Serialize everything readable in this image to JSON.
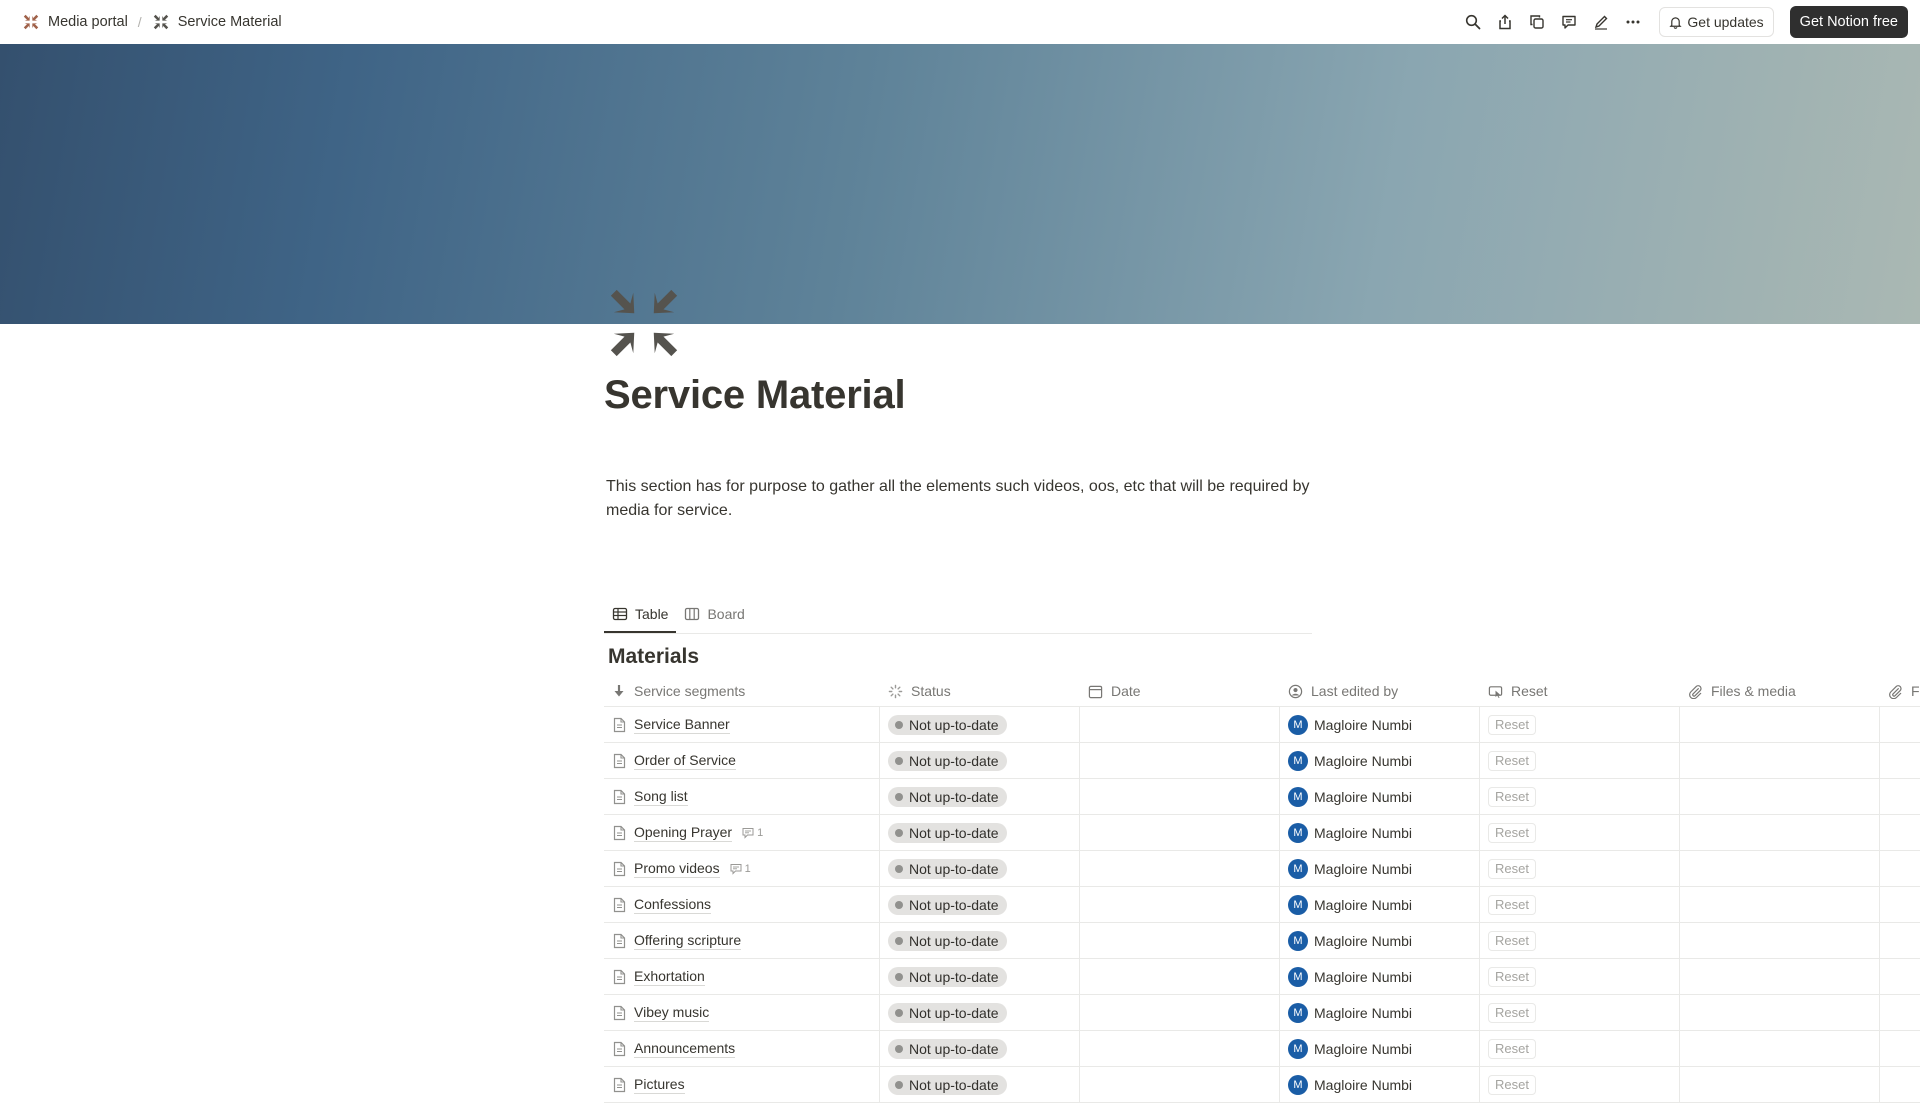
{
  "breadcrumb": [
    {
      "label": "Media portal"
    },
    {
      "label": "Service Material"
    }
  ],
  "topbar": {
    "separator": "/",
    "get_updates": "Get updates",
    "get_notion_free": "Get Notion free"
  },
  "page": {
    "title": "Service Material",
    "description": "This section has for purpose to gather all the elements such videos, oos, etc that will be required by media for service."
  },
  "views": [
    {
      "label": "Table",
      "icon": "table-icon",
      "active": true
    },
    {
      "label": "Board",
      "icon": "board-icon",
      "active": false
    }
  ],
  "database": {
    "title": "Materials",
    "columns": [
      {
        "label": "Service segments",
        "icon": "sort-arrow-icon"
      },
      {
        "label": "Status",
        "icon": "status-icon"
      },
      {
        "label": "Date",
        "icon": "calendar-icon"
      },
      {
        "label": "Last edited by",
        "icon": "person-icon"
      },
      {
        "label": "Reset",
        "icon": "button-icon"
      },
      {
        "label": "Files & media",
        "icon": "paperclip-icon"
      },
      {
        "label": "F",
        "icon": "paperclip-icon"
      }
    ],
    "rows": [
      {
        "name": "Service Banner",
        "comments": "",
        "status": "Not up-to-date",
        "date": "",
        "editor": "Magloire Numbi",
        "editor_initial": "M",
        "reset": "Reset"
      },
      {
        "name": "Order of Service",
        "comments": "",
        "status": "Not up-to-date",
        "date": "",
        "editor": "Magloire Numbi",
        "editor_initial": "M",
        "reset": "Reset"
      },
      {
        "name": "Song list",
        "comments": "",
        "status": "Not up-to-date",
        "date": "",
        "editor": "Magloire Numbi",
        "editor_initial": "M",
        "reset": "Reset"
      },
      {
        "name": "Opening Prayer",
        "comments": "1",
        "status": "Not up-to-date",
        "date": "",
        "editor": "Magloire Numbi",
        "editor_initial": "M",
        "reset": "Reset"
      },
      {
        "name": "Promo videos",
        "comments": "1",
        "status": "Not up-to-date",
        "date": "",
        "editor": "Magloire Numbi",
        "editor_initial": "M",
        "reset": "Reset"
      },
      {
        "name": "Confessions",
        "comments": "",
        "status": "Not up-to-date",
        "date": "",
        "editor": "Magloire Numbi",
        "editor_initial": "M",
        "reset": "Reset"
      },
      {
        "name": "Offering scripture",
        "comments": "",
        "status": "Not up-to-date",
        "date": "",
        "editor": "Magloire Numbi",
        "editor_initial": "M",
        "reset": "Reset"
      },
      {
        "name": "Exhortation",
        "comments": "",
        "status": "Not up-to-date",
        "date": "",
        "editor": "Magloire Numbi",
        "editor_initial": "M",
        "reset": "Reset"
      },
      {
        "name": "Vibey music",
        "comments": "",
        "status": "Not up-to-date",
        "date": "",
        "editor": "Magloire Numbi",
        "editor_initial": "M",
        "reset": "Reset"
      },
      {
        "name": "Announcements",
        "comments": "",
        "status": "Not up-to-date",
        "date": "",
        "editor": "Magloire Numbi",
        "editor_initial": "M",
        "reset": "Reset"
      },
      {
        "name": "Pictures",
        "comments": "",
        "status": "Not up-to-date",
        "date": "",
        "editor": "Magloire Numbi",
        "editor_initial": "M",
        "reset": "Reset"
      }
    ]
  },
  "colors": {
    "avatar": "#1a5da6",
    "status_pill_bg": "#e3e2e0",
    "status_dot": "#91918e",
    "primary_button": "#2f2f2f"
  }
}
